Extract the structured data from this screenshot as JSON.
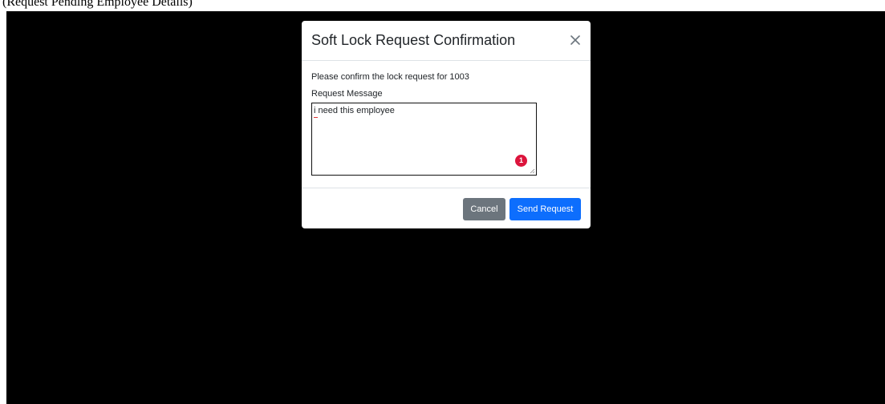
{
  "background": {
    "top_strip_text": "(Request Pending Employee Details)"
  },
  "modal": {
    "title": "Soft Lock Request Confirmation",
    "confirm_text": "Please confirm the lock request for 1003",
    "field_label": "Request Message",
    "message_value": "i need this employee",
    "error_badge": "1",
    "buttons": {
      "cancel": "Cancel",
      "send": "Send Request"
    }
  },
  "colors": {
    "backdrop": "#000000",
    "cancel": "#6c757d",
    "send": "#0d6efd",
    "badge": "#dc143c"
  },
  "icons": {
    "close": "close-icon",
    "resize": "resize-grip-icon"
  }
}
